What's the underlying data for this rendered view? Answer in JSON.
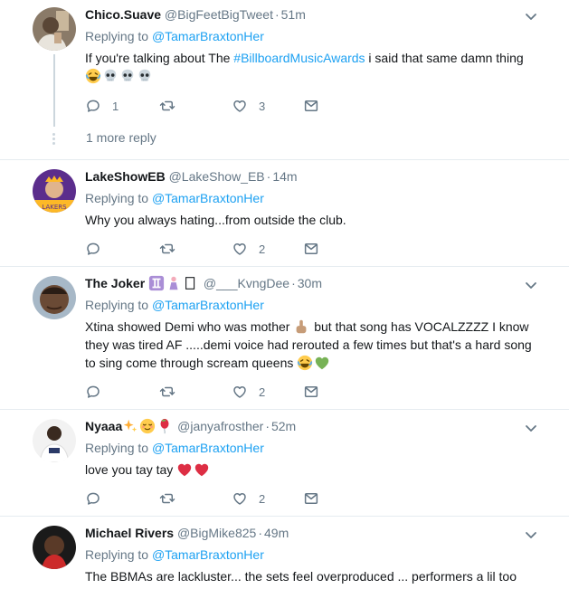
{
  "colors": {
    "link": "#1da1f2",
    "muted": "#657786",
    "divider": "#e6ecf0",
    "text": "#14171a"
  },
  "tweets": [
    {
      "name": "Chico.Suave",
      "handle": "@BigFeetBigTweet",
      "time": "51m",
      "replying_prefix": "Replying to",
      "replying_to": "@TamarBraxtonHer",
      "text_before": "If you're talking about The ",
      "hashtag": "#BillboardMusicAwards",
      "text_after": " i said that same damn thing",
      "emojis": [
        "laughing-crying",
        "skull",
        "skull",
        "skull"
      ],
      "reply_count": "1",
      "retweet_count": "",
      "like_count": "3",
      "more_reply": "1 more reply"
    },
    {
      "name": "LakeShowEB",
      "handle": "@LakeShow_EB",
      "time": "14m",
      "replying_prefix": "Replying to",
      "replying_to": "@TamarBraxtonHer",
      "text": "Why you always hating...from outside the club.",
      "reply_count": "",
      "retweet_count": "",
      "like_count": "2"
    },
    {
      "name": "The Joker",
      "name_emojis": [
        "gemini",
        "person",
        "box"
      ],
      "handle": "@___KvngDee",
      "time": "30m",
      "replying_prefix": "Replying to",
      "replying_to": "@TamarBraxtonHer",
      "text_part1": "Xtina showed Demi who was mother ",
      "text_part2": " but that song has VOCALZZZZ I know they was tired AF .....demi voice had rerouted a few times but that's a hard song to sing come through scream queens ",
      "emojis": [
        "laughing-crying",
        "green-heart"
      ],
      "reply_count": "",
      "retweet_count": "",
      "like_count": "2"
    },
    {
      "name": "Nyaaa",
      "name_emojis": [
        "sparkles",
        "relieved",
        "balloon"
      ],
      "handle": "@janyafrosther",
      "time": "52m",
      "replying_prefix": "Replying to",
      "replying_to": "@TamarBraxtonHer",
      "text": "love you tay tay ",
      "emojis": [
        "red-heart",
        "red-heart"
      ],
      "reply_count": "",
      "retweet_count": "",
      "like_count": "2"
    },
    {
      "name": "Michael Rivers",
      "handle": "@BigMike825",
      "time": "49m",
      "replying_prefix": "Replying to",
      "replying_to": "@TamarBraxtonHer",
      "text": "The BBMAs are lackluster... the sets feel overproduced ... performers a lil too"
    }
  ]
}
